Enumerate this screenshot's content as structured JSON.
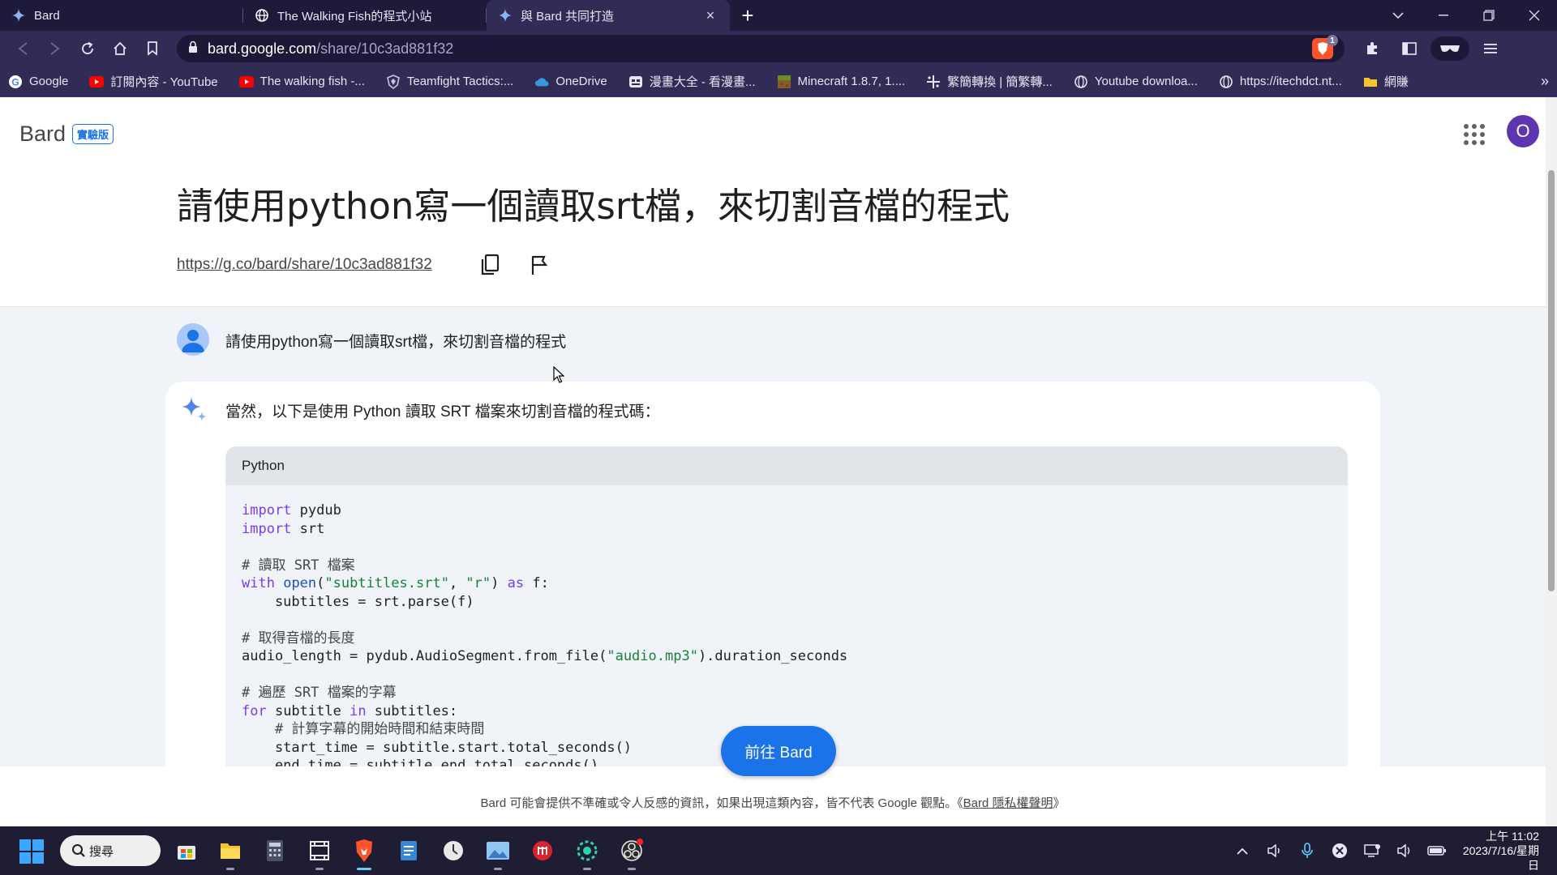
{
  "browser": {
    "tabs": [
      {
        "label": "Bard",
        "icon": "bard-sparkle-icon",
        "active": false
      },
      {
        "label": "The Walking Fish的程式小站",
        "icon": "globe-icon",
        "active": false
      },
      {
        "label": "與 Bard 共同打造",
        "icon": "bard-sparkle-icon",
        "active": true,
        "close": "×"
      }
    ],
    "new_tab": "+",
    "address": {
      "host": "bard.google.com",
      "path": "/share/10c3ad881f32"
    },
    "shield_count": "1",
    "bookmarks": [
      {
        "label": "Google",
        "icon": "google-icon"
      },
      {
        "label": "訂閱內容 - YouTube",
        "icon": "youtube-icon"
      },
      {
        "label": "The walking fish -...",
        "icon": "youtube-icon"
      },
      {
        "label": "Teamfight Tactics:...",
        "icon": "shield-crest-icon"
      },
      {
        "label": "OneDrive",
        "icon": "cloud-icon"
      },
      {
        "label": "漫畫大全 - 看漫畫...",
        "icon": "manga-icon"
      },
      {
        "label": "Minecraft 1.8.7, 1....",
        "icon": "minecraft-icon"
      },
      {
        "label": "繁簡轉換 | 簡繁轉...",
        "icon": "sparkle-dots-icon"
      },
      {
        "label": "Youtube downloa...",
        "icon": "globe-icon"
      },
      {
        "label": "https://itechdct.nt...",
        "icon": "globe-icon"
      },
      {
        "label": "網賺",
        "icon": "folder-icon"
      }
    ],
    "bookmarks_more": "»"
  },
  "page": {
    "logo": "Bard",
    "badge": "實驗版",
    "avatar_initial": "O",
    "title": "請使用python寫一個讀取srt檔，來切割音檔的程式",
    "share_link": "https://g.co/bard/share/10c3ad881f32",
    "user_prompt": "請使用python寫一個讀取srt檔，來切割音檔的程式",
    "response_intro": "當然，以下是使用 Python 讀取 SRT 檔案來切割音檔的程式碼：",
    "code_lang": "Python",
    "code_lines": [
      "import pydub",
      "import srt",
      "",
      "# 讀取 SRT 檔案",
      "with open(\"subtitles.srt\", \"r\") as f:",
      "    subtitles = srt.parse(f)",
      "",
      "# 取得音檔的長度",
      "audio_length = pydub.AudioSegment.from_file(\"audio.mp3\").duration_seconds",
      "",
      "# 遍歷 SRT 檔案的字幕",
      "for subtitle in subtitles:",
      "    # 計算字幕的開始時間和結束時間",
      "    start_time = subtitle.start.total_seconds()",
      "    end_time = subtitle.end.total_seconds()"
    ],
    "goto_button": "前往 Bard",
    "disclaimer_prefix": "Bard 可能會提供不準確或令人反感的資訊，如果出現這類內容，皆不代表 Google 觀點。《",
    "disclaimer_link": "Bard 隱私權聲明",
    "disclaimer_suffix": "》"
  },
  "taskbar": {
    "search_label": "搜尋",
    "apps": [
      "store-icon",
      "file-explorer-icon",
      "calculator-icon",
      "video-editor-icon",
      "brave-browser-icon",
      "notepad-icon",
      "clock-app-icon",
      "photos-icon",
      "red-app-icon",
      "green-circle-app-icon",
      "obs-icon"
    ],
    "clock_time": "上午 11:02",
    "clock_date": "2023/7/16/星期日"
  },
  "colors": {
    "accent": "#1a73e8",
    "chrome_bg": "#302c55",
    "avatar": "#5e35b1"
  }
}
